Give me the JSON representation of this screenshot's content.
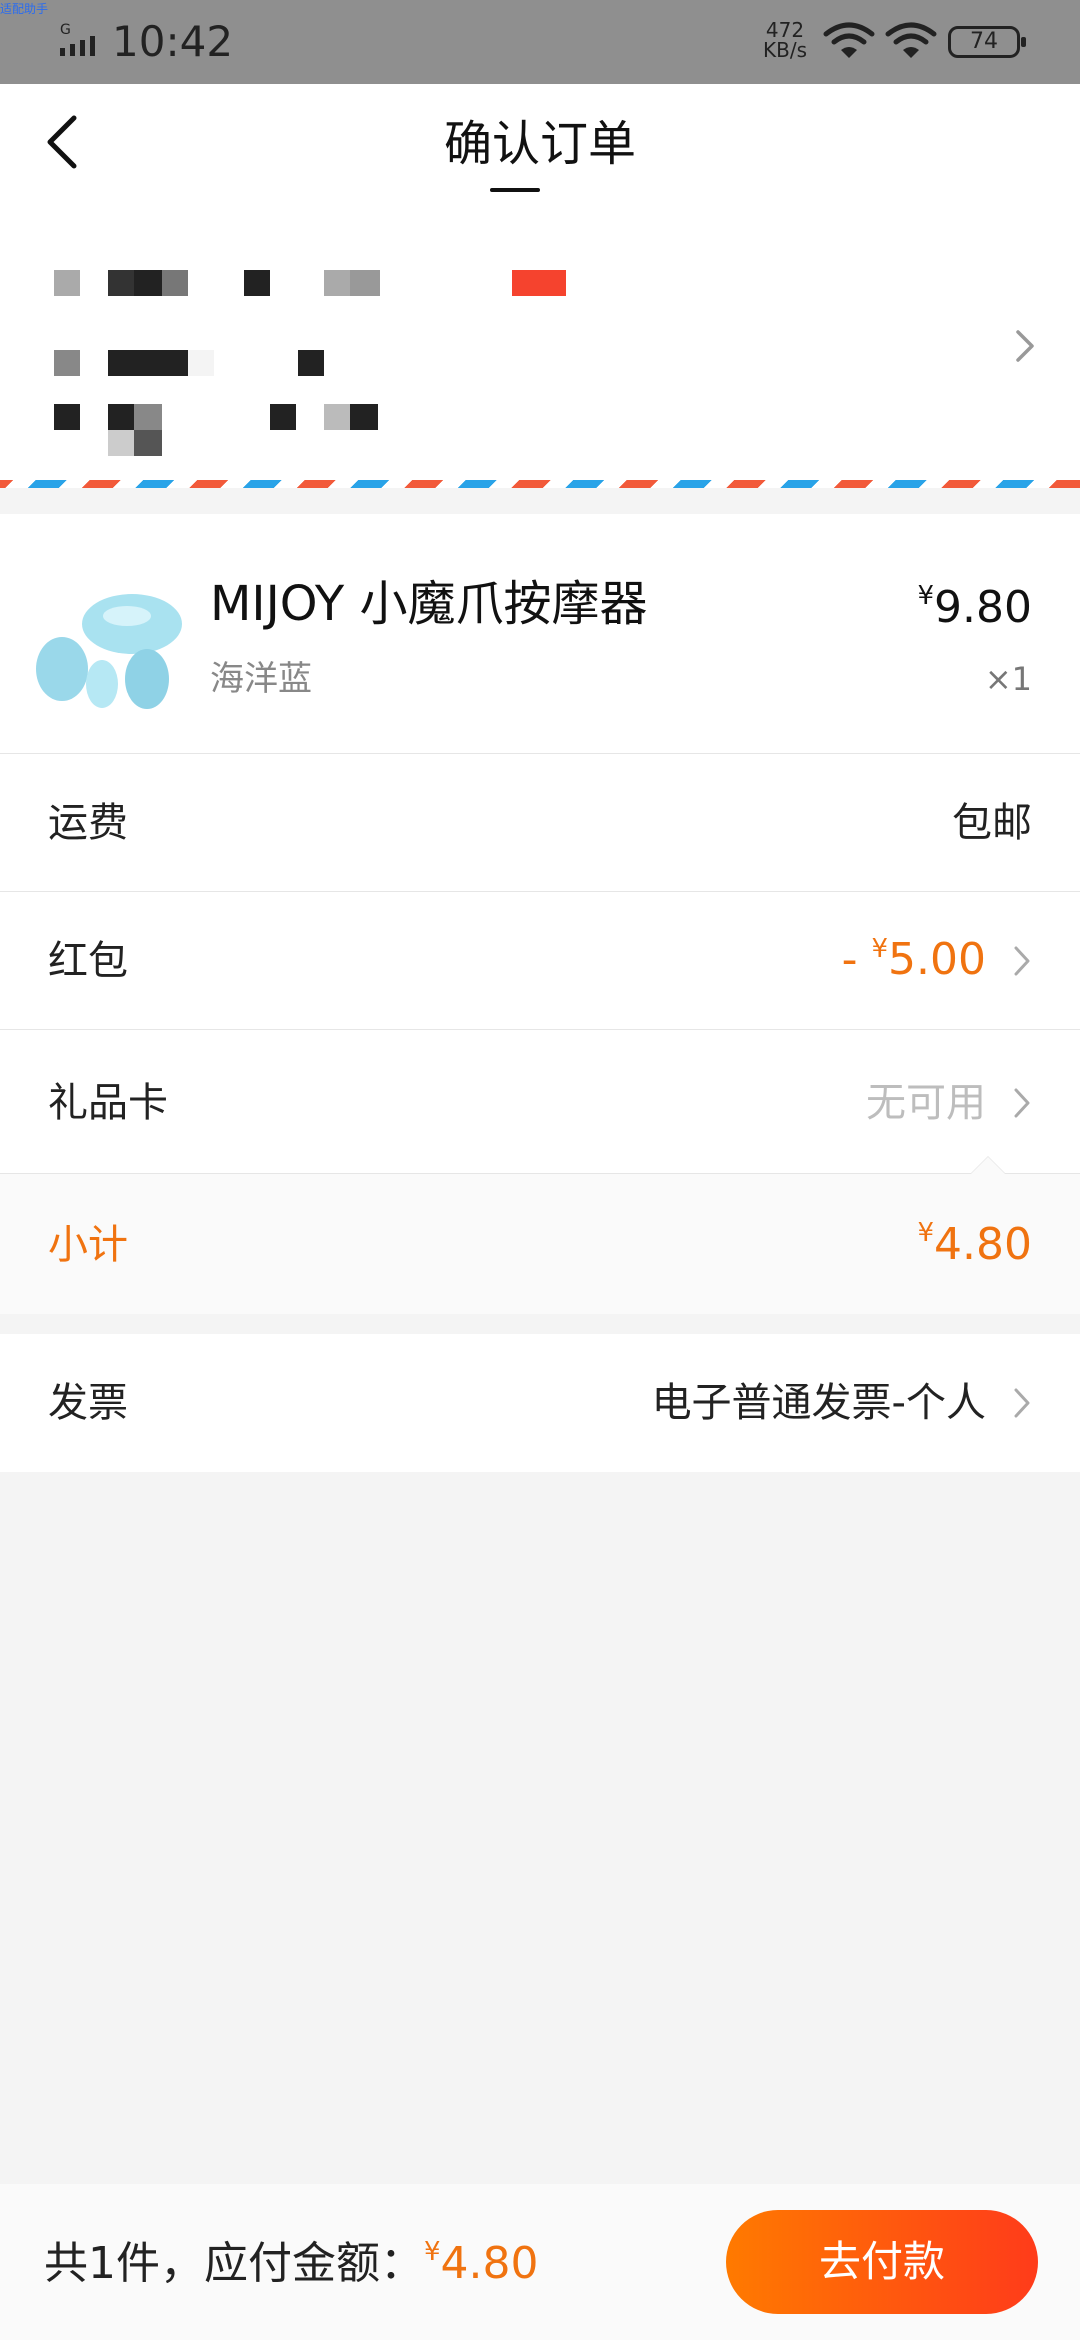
{
  "status_bar": {
    "corner_text": "适配助手",
    "network_type": "G",
    "time": "10:42",
    "net_speed_value": "472",
    "net_speed_unit": "KB/s",
    "battery": "74"
  },
  "header": {
    "title": "确认订单",
    "back_icon": "chevron-left-icon"
  },
  "address": {
    "note": "",
    "chevron_icon": "chevron-right-icon"
  },
  "product": {
    "name": "MIJOY 小魔爪按摩器",
    "variant": "海洋蓝",
    "price_symbol": "¥",
    "price": "9.80",
    "quantity": "×1",
    "thumb_color": "#9fdcec"
  },
  "rows": {
    "shipping": {
      "label": "运费",
      "value": "包邮"
    },
    "red_packet": {
      "label": "红包",
      "prefix": "- ",
      "symbol": "¥",
      "value": "5.00"
    },
    "gift_card": {
      "label": "礼品卡",
      "value": "无可用"
    },
    "subtotal": {
      "label": "小计",
      "symbol": "¥",
      "value": "4.80"
    },
    "invoice": {
      "label": "发票",
      "value": "电子普通发票-个人"
    }
  },
  "bottom_bar": {
    "summary_prefix": "共1件，应付金额：",
    "symbol": "¥",
    "amount": "4.80",
    "pay_label": "去付款"
  },
  "colors": {
    "accent": "#f07310",
    "pay_gradient_start": "#ff7a00",
    "pay_gradient_end": "#ff3b1a",
    "status_bar_bg": "#8f8f8f"
  }
}
